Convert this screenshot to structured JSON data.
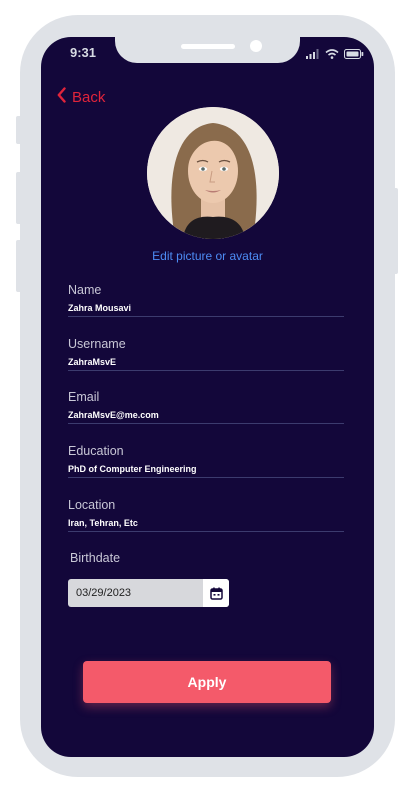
{
  "status_bar": {
    "time": "9:31",
    "icons": [
      "signal-icon",
      "wifi-icon",
      "battery-icon"
    ]
  },
  "nav": {
    "back_label": "Back",
    "back_icon": "chevron-left-icon"
  },
  "profile": {
    "edit_label": "Edit picture or avatar"
  },
  "fields": [
    {
      "label": "Name",
      "value": "Zahra Mousavi"
    },
    {
      "label": "Username",
      "value": "ZahraMsvE"
    },
    {
      "label": "Email",
      "value": "ZahraMsvE@me.com"
    },
    {
      "label": "Education",
      "value": "PhD of Computer Engineering"
    },
    {
      "label": "Location",
      "value": "Iran, Tehran, Etc"
    }
  ],
  "birthdate": {
    "label": "Birthdate",
    "value": "03/29/2023",
    "icon": "calendar-icon"
  },
  "actions": {
    "apply_label": "Apply"
  },
  "colors": {
    "screen_bg": "#13073a",
    "accent": "#f45a6a",
    "back": "#e0243b",
    "link": "#4d8cf5",
    "frame": "#dfe2e7"
  }
}
